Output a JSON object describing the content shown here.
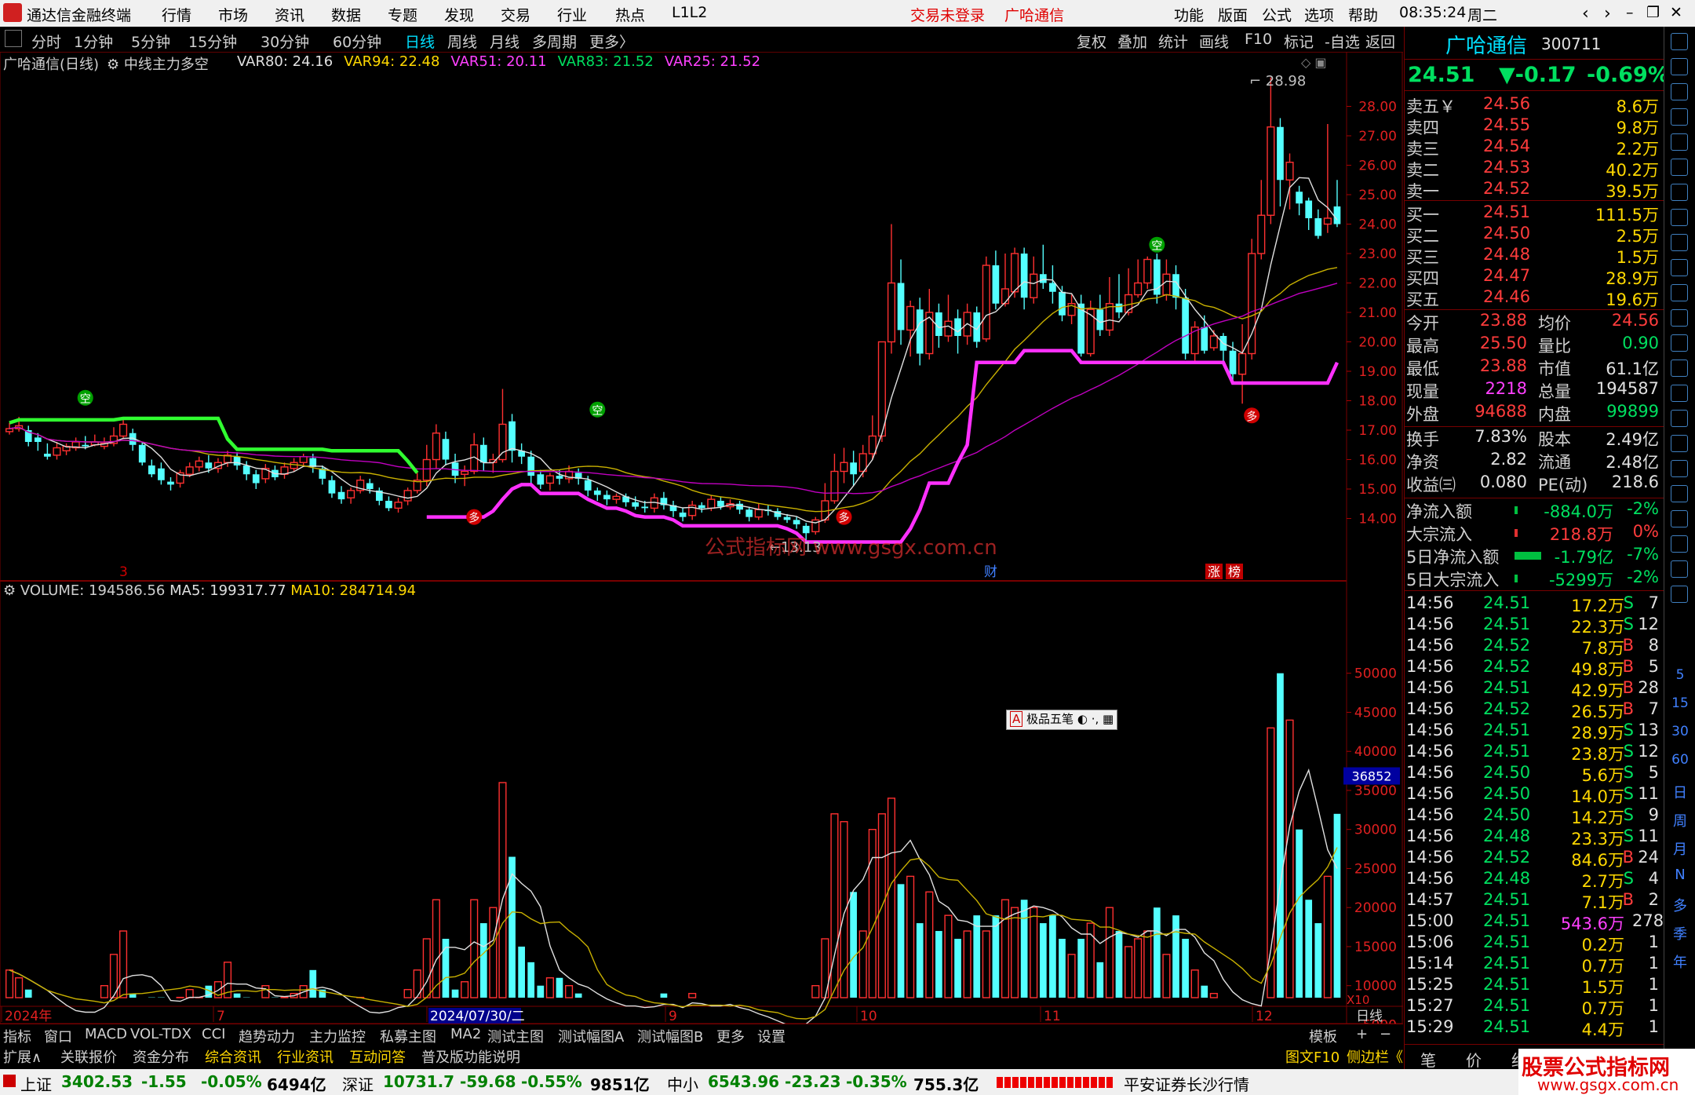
{
  "titlebar": {
    "app_name": "通达信金融终端",
    "menu": [
      "行情",
      "市场",
      "资讯",
      "数据",
      "专题",
      "发现",
      "交易",
      "行业",
      "热点",
      "L1L2"
    ],
    "notice_login": "交易未登录",
    "notice_stock": "广哈通信",
    "right_menu": [
      "功能",
      "版面",
      "公式",
      "选项",
      "帮助"
    ],
    "time": "08:35:24",
    "weekday": "周二"
  },
  "toolbar": {
    "periods": [
      "分时",
      "1分钟",
      "5分钟",
      "15分钟",
      "30分钟",
      "60分钟",
      "日线",
      "周线",
      "月线",
      "多周期",
      "更多〉"
    ],
    "active": "日线",
    "tools": [
      "复权",
      "叠加",
      "统计",
      "画线",
      "F10",
      "标记",
      "-自选",
      "返回"
    ]
  },
  "chart": {
    "title": "广哈通信(日线)",
    "indicator_name": "中线主力多空",
    "vars": [
      {
        "label": "VAR80: 24.16",
        "color": "#e0e0e0"
      },
      {
        "label": "VAR94: 22.48",
        "color": "#ffd800"
      },
      {
        "label": "VAR51: 20.11",
        "color": "#ff40ff"
      },
      {
        "label": "VAR83: 21.52",
        "color": "#00e060"
      },
      {
        "label": "VAR25: 21.52",
        "color": "#ff40ff"
      }
    ],
    "price_ticks": [
      "28.00",
      "27.00",
      "26.00",
      "25.00",
      "24.00",
      "23.00",
      "22.00",
      "21.00",
      "20.00",
      "19.00",
      "18.00",
      "17.00",
      "16.00",
      "15.00",
      "14.00"
    ],
    "high_label": "28.98",
    "low_label": "13.13",
    "watermark": "公式指标网 www.gsgx.com.cn",
    "markers": {
      "duo": "多",
      "kong": "空",
      "cai": "财",
      "zhang": "涨",
      "bang": "榜",
      "three": "3"
    },
    "volume_header": "VOLUME: 194586.56",
    "ma5_header": "MA5: 199317.77",
    "ma10_header": "MA10: 284714.94",
    "volume_ticks": [
      "50000",
      "45000",
      "40000",
      "35000",
      "30000",
      "25000",
      "20000",
      "15000",
      "10000",
      "5000"
    ],
    "volume_cursor": "36852",
    "volume_unit": "X10",
    "popup": "极品五笔",
    "date_labels": [
      "2024年",
      "7",
      "2024/07/30/二",
      "9",
      "10",
      "11",
      "12"
    ],
    "date_right": "日线"
  },
  "quote": {
    "name": "广哈通信",
    "code": "300711",
    "price": "24.51",
    "change": "▼-0.17",
    "pct": "-0.69%",
    "asks": [
      {
        "label": "卖五￥",
        "price": "24.56",
        "vol": "8.6万"
      },
      {
        "label": "卖四",
        "price": "24.55",
        "vol": "9.8万"
      },
      {
        "label": "卖三",
        "price": "24.54",
        "vol": "2.2万"
      },
      {
        "label": "卖二",
        "price": "24.53",
        "vol": "40.2万"
      },
      {
        "label": "卖一",
        "price": "24.52",
        "vol": "39.5万"
      }
    ],
    "bids": [
      {
        "label": "买一",
        "price": "24.51",
        "vol": "111.5万"
      },
      {
        "label": "买二",
        "price": "24.50",
        "vol": "2.5万"
      },
      {
        "label": "买三",
        "price": "24.48",
        "vol": "1.5万"
      },
      {
        "label": "买四",
        "price": "24.47",
        "vol": "28.9万"
      },
      {
        "label": "买五",
        "price": "24.46",
        "vol": "19.6万"
      }
    ],
    "stats": [
      {
        "l1": "今开",
        "v1": "23.88",
        "c1": "red",
        "l2": "均价",
        "v2": "24.56",
        "c2": "red"
      },
      {
        "l1": "最高",
        "v1": "25.50",
        "c1": "red",
        "l2": "量比",
        "v2": "0.90",
        "c2": "grn"
      },
      {
        "l1": "最低",
        "v1": "23.88",
        "c1": "red",
        "l2": "市值",
        "v2": "61.1亿",
        "c2": "wht"
      },
      {
        "l1": "现量",
        "v1": "2218",
        "c1": "mag",
        "l2": "总量",
        "v2": "194587",
        "c2": "wht"
      },
      {
        "l1": "外盘",
        "v1": "94688",
        "c1": "red",
        "l2": "内盘",
        "v2": "99899",
        "c2": "grn"
      }
    ],
    "stats2": [
      {
        "l1": "换手",
        "v1": "7.83%",
        "l2": "股本",
        "v2": "2.49亿"
      },
      {
        "l1": "净资",
        "v1": "2.82",
        "l2": "流通",
        "v2": "2.48亿"
      },
      {
        "l1": "收益㈢",
        "v1": "0.080",
        "l2": "PE(动)",
        "v2": "218.6"
      }
    ],
    "flows": [
      {
        "label": "净流入额",
        "value": "-884.0万",
        "pct": "-2%"
      },
      {
        "label": "大宗流入",
        "value": "218.8万",
        "pct": "0%"
      },
      {
        "label": "5日净流入额",
        "value": "-1.79亿",
        "pct": "-7%"
      },
      {
        "label": "5日大宗流入",
        "value": "-5299万",
        "pct": "-2%"
      }
    ],
    "ticks": [
      {
        "t": "14:56",
        "p": "24.51",
        "v": "17.2万",
        "s": "S",
        "n": "7"
      },
      {
        "t": "14:56",
        "p": "24.51",
        "v": "22.3万",
        "s": "S",
        "n": "12"
      },
      {
        "t": "14:56",
        "p": "24.52",
        "v": "7.8万",
        "s": "B",
        "n": "8"
      },
      {
        "t": "14:56",
        "p": "24.52",
        "v": "49.8万",
        "s": "B",
        "n": "5"
      },
      {
        "t": "14:56",
        "p": "24.51",
        "v": "42.9万",
        "s": "B",
        "n": "28"
      },
      {
        "t": "14:56",
        "p": "24.52",
        "v": "26.5万",
        "s": "B",
        "n": "7"
      },
      {
        "t": "14:56",
        "p": "24.51",
        "v": "28.9万",
        "s": "S",
        "n": "13"
      },
      {
        "t": "14:56",
        "p": "24.51",
        "v": "23.8万",
        "s": "S",
        "n": "12"
      },
      {
        "t": "14:56",
        "p": "24.50",
        "v": "5.6万",
        "s": "S",
        "n": "5"
      },
      {
        "t": "14:56",
        "p": "24.50",
        "v": "14.0万",
        "s": "S",
        "n": "11"
      },
      {
        "t": "14:56",
        "p": "24.50",
        "v": "14.2万",
        "s": "S",
        "n": "9"
      },
      {
        "t": "14:56",
        "p": "24.48",
        "v": "23.3万",
        "s": "S",
        "n": "11"
      },
      {
        "t": "14:56",
        "p": "24.52",
        "v": "84.6万",
        "s": "B",
        "n": "24"
      },
      {
        "t": "14:56",
        "p": "24.48",
        "v": "2.7万",
        "s": "S",
        "n": "4"
      },
      {
        "t": "14:57",
        "p": "24.51",
        "v": "7.1万",
        "s": "B",
        "n": "2"
      },
      {
        "t": "15:00",
        "p": "24.51",
        "v": "543.6万",
        "s": "",
        "n": "278"
      },
      {
        "t": "15:06",
        "p": "24.51",
        "v": "0.2万",
        "s": "",
        "n": "1"
      },
      {
        "t": "15:14",
        "p": "24.51",
        "v": "0.7万",
        "s": "",
        "n": "1"
      },
      {
        "t": "15:25",
        "p": "24.51",
        "v": "1.5万",
        "s": "",
        "n": "1"
      },
      {
        "t": "15:27",
        "p": "24.51",
        "v": "0.7万",
        "s": "",
        "n": "1"
      },
      {
        "t": "15:29",
        "p": "24.51",
        "v": "4.4万",
        "s": "",
        "n": "1"
      }
    ],
    "bottom_tabs": [
      "笔",
      "价",
      "细",
      "势"
    ],
    "f10": "图文F10",
    "sidebar": "侧边栏《"
  },
  "right_strip": [
    "日",
    "周",
    "月",
    "N",
    "多",
    "季",
    "年"
  ],
  "right_strip_nums": [
    "5",
    "15",
    "30",
    "60"
  ],
  "tabs1": [
    "指标",
    "窗口",
    "MACD",
    "VOL-TDX",
    "CCI",
    "趋势动力",
    "主力监控",
    "私募主图",
    "MA2",
    "测试主图",
    "测试幅图A",
    "测试幅图B",
    "更多",
    "设置"
  ],
  "tabs1_right": [
    "模板",
    "+",
    "−"
  ],
  "tabs2": [
    "扩展∧",
    "关联报价",
    "资金分布",
    "综合资讯",
    "行业资讯",
    "互动问答",
    "普及版功能说明"
  ],
  "status": {
    "sh_label": "上证",
    "sh_val": "3402.53",
    "sh_chg": "-1.55",
    "sh_pct": "-0.05%",
    "sh_amt": "6494亿",
    "sz_label": "深证",
    "sz_val": "10731.7",
    "sz_chg": "-59.68",
    "sz_pct": "-0.55%",
    "sz_amt": "9851亿",
    "zx_label": "中小",
    "zx_val": "6543.96",
    "zx_chg": "-23.23",
    "zx_pct": "-0.35%",
    "zx_amt": "755.3亿",
    "server": "平安证券长沙行情"
  },
  "brand": {
    "cn": "股票公式指标网",
    "url": "www.gsgx.com.cn"
  },
  "candles": [
    [
      16.95,
      17.05,
      17.25,
      16.85
    ],
    [
      17.05,
      17.15,
      17.45,
      16.95
    ],
    [
      17.0,
      16.6,
      17.15,
      16.45
    ],
    [
      16.75,
      16.6,
      16.9,
      16.3
    ],
    [
      16.2,
      16.1,
      16.55,
      16.0
    ],
    [
      16.15,
      16.4,
      16.6,
      16.0
    ],
    [
      16.3,
      16.45,
      16.55,
      16.15
    ],
    [
      16.4,
      16.6,
      16.75,
      16.3
    ],
    [
      16.5,
      16.45,
      16.8,
      16.35
    ],
    [
      16.5,
      16.6,
      16.85,
      16.45
    ],
    [
      16.45,
      16.55,
      16.75,
      16.35
    ],
    [
      16.55,
      16.8,
      17.1,
      16.45
    ],
    [
      16.8,
      17.2,
      17.45,
      16.7
    ],
    [
      16.9,
      16.5,
      17.05,
      16.3
    ],
    [
      16.5,
      15.9,
      16.6,
      15.8
    ],
    [
      15.8,
      15.5,
      16.0,
      15.4
    ],
    [
      15.7,
      15.3,
      15.9,
      15.15
    ],
    [
      15.25,
      15.15,
      15.4,
      14.95
    ],
    [
      15.2,
      15.55,
      15.65,
      15.05
    ],
    [
      15.5,
      15.75,
      15.9,
      15.4
    ],
    [
      15.75,
      15.95,
      16.1,
      15.6
    ],
    [
      15.9,
      15.7,
      16.15,
      15.55
    ],
    [
      15.7,
      15.9,
      16.05,
      15.55
    ],
    [
      15.9,
      16.15,
      16.3,
      15.75
    ],
    [
      16.1,
      15.8,
      16.25,
      15.65
    ],
    [
      15.8,
      15.5,
      15.95,
      15.3
    ],
    [
      15.5,
      15.2,
      15.65,
      15.0
    ],
    [
      15.35,
      15.7,
      15.85,
      15.2
    ],
    [
      15.65,
      15.4,
      15.8,
      15.3
    ],
    [
      15.5,
      15.75,
      15.9,
      15.35
    ],
    [
      15.7,
      15.9,
      16.05,
      15.6
    ],
    [
      15.9,
      16.1,
      16.2,
      15.75
    ],
    [
      16.05,
      15.75,
      16.2,
      15.55
    ],
    [
      15.7,
      15.35,
      15.8,
      15.15
    ],
    [
      15.3,
      14.85,
      15.45,
      14.7
    ],
    [
      14.9,
      14.65,
      15.1,
      14.5
    ],
    [
      14.7,
      14.95,
      15.05,
      14.5
    ],
    [
      14.95,
      15.3,
      15.45,
      14.85
    ],
    [
      15.2,
      15.0,
      15.35,
      14.85
    ],
    [
      14.95,
      14.6,
      15.05,
      14.45
    ],
    [
      14.6,
      14.35,
      14.75,
      14.25
    ],
    [
      14.35,
      14.55,
      14.7,
      14.2
    ],
    [
      14.6,
      14.95,
      15.05,
      14.45
    ],
    [
      14.95,
      15.3,
      15.55,
      14.85
    ],
    [
      15.3,
      16.0,
      16.5,
      15.1
    ],
    [
      16.0,
      16.9,
      17.2,
      15.7
    ],
    [
      16.7,
      16.0,
      16.95,
      15.8
    ],
    [
      15.9,
      15.45,
      16.2,
      15.2
    ],
    [
      15.5,
      15.6,
      15.8,
      15.1
    ],
    [
      15.6,
      16.5,
      16.9,
      15.5
    ],
    [
      16.5,
      15.9,
      16.75,
      15.6
    ],
    [
      15.9,
      16.0,
      16.2,
      15.55
    ],
    [
      16.0,
      17.2,
      18.4,
      15.9
    ],
    [
      17.3,
      16.3,
      17.55,
      15.9
    ],
    [
      16.3,
      16.1,
      16.55,
      15.85
    ],
    [
      16.1,
      15.45,
      16.3,
      15.2
    ],
    [
      15.5,
      15.15,
      15.65,
      15.0
    ],
    [
      15.2,
      15.45,
      15.55,
      14.95
    ],
    [
      15.45,
      15.35,
      15.65,
      15.15
    ],
    [
      15.35,
      15.6,
      15.8,
      15.2
    ],
    [
      15.55,
      15.35,
      15.7,
      15.15
    ],
    [
      15.3,
      14.95,
      15.45,
      14.75
    ],
    [
      14.95,
      14.8,
      15.05,
      14.6
    ],
    [
      14.8,
      14.65,
      14.95,
      14.45
    ],
    [
      14.65,
      14.75,
      14.85,
      14.5
    ],
    [
      14.75,
      14.55,
      14.85,
      14.4
    ],
    [
      14.55,
      14.4,
      14.75,
      14.3
    ],
    [
      14.4,
      14.35,
      14.6,
      14.2
    ],
    [
      14.35,
      14.7,
      14.85,
      14.2
    ],
    [
      14.7,
      14.45,
      14.9,
      14.3
    ],
    [
      14.45,
      14.25,
      14.6,
      14.05
    ],
    [
      14.2,
      14.05,
      14.35,
      13.9
    ],
    [
      14.1,
      14.45,
      14.6,
      13.95
    ],
    [
      14.45,
      14.35,
      14.55,
      14.2
    ],
    [
      14.35,
      14.65,
      14.8,
      14.25
    ],
    [
      14.6,
      14.4,
      14.75,
      14.3
    ],
    [
      14.4,
      14.5,
      14.65,
      14.3
    ],
    [
      14.5,
      14.3,
      14.6,
      14.15
    ],
    [
      14.3,
      14.05,
      14.4,
      13.9
    ],
    [
      14.05,
      14.3,
      14.5,
      13.95
    ],
    [
      14.3,
      14.25,
      14.45,
      14.1
    ],
    [
      14.25,
      14.05,
      14.35,
      13.95
    ],
    [
      14.05,
      13.95,
      14.15,
      13.85
    ],
    [
      13.95,
      13.8,
      14.05,
      13.65
    ],
    [
      13.75,
      13.5,
      13.85,
      13.13
    ],
    [
      13.55,
      13.95,
      14.05,
      13.45
    ],
    [
      13.95,
      14.6,
      15.2,
      13.85
    ],
    [
      14.6,
      15.6,
      16.2,
      14.5
    ],
    [
      15.6,
      15.9,
      16.4,
      15.2
    ],
    [
      15.9,
      15.5,
      16.3,
      15.1
    ],
    [
      15.6,
      16.2,
      16.5,
      15.4
    ],
    [
      16.2,
      16.8,
      17.5,
      16.0
    ],
    [
      16.8,
      20.0,
      20.0,
      16.6
    ],
    [
      20.0,
      22.0,
      24.0,
      19.6
    ],
    [
      22.0,
      20.4,
      22.8,
      19.9
    ],
    [
      20.4,
      21.2,
      21.4,
      19.5
    ],
    [
      21.1,
      19.6,
      21.5,
      19.2
    ],
    [
      19.6,
      21.0,
      21.8,
      19.4
    ],
    [
      21.0,
      20.2,
      21.3,
      19.8
    ],
    [
      20.2,
      20.7,
      21.6,
      20.0
    ],
    [
      20.8,
      20.2,
      21.1,
      19.6
    ],
    [
      20.2,
      21.0,
      21.3,
      19.9
    ],
    [
      21.0,
      20.0,
      21.2,
      19.8
    ],
    [
      20.1,
      22.6,
      22.9,
      20.0
    ],
    [
      22.6,
      21.3,
      23.1,
      21.1
    ],
    [
      21.3,
      21.8,
      23.0,
      21.2
    ],
    [
      21.7,
      23.0,
      23.2,
      21.5
    ],
    [
      23.0,
      21.5,
      23.2,
      21.1
    ],
    [
      21.5,
      22.3,
      22.9,
      21.3
    ],
    [
      22.3,
      22.0,
      23.3,
      21.8
    ],
    [
      22.0,
      21.7,
      22.6,
      21.3
    ],
    [
      21.7,
      20.9,
      21.9,
      20.7
    ],
    [
      20.9,
      21.3,
      21.6,
      20.6
    ],
    [
      21.3,
      19.6,
      21.6,
      19.5
    ],
    [
      19.6,
      21.1,
      21.4,
      19.5
    ],
    [
      21.1,
      20.4,
      21.6,
      20.2
    ],
    [
      20.4,
      21.3,
      22.2,
      20.2
    ],
    [
      21.3,
      21.0,
      22.3,
      20.8
    ],
    [
      21.0,
      21.6,
      22.5,
      20.9
    ],
    [
      21.6,
      22.0,
      22.8,
      21.5
    ],
    [
      22.0,
      22.8,
      22.9,
      21.8
    ],
    [
      22.8,
      21.6,
      23.0,
      21.3
    ],
    [
      21.6,
      22.3,
      22.8,
      21.4
    ],
    [
      22.3,
      21.5,
      22.6,
      21.1
    ],
    [
      21.5,
      19.6,
      21.8,
      19.4
    ],
    [
      19.6,
      20.5,
      20.7,
      19.3
    ],
    [
      20.5,
      19.7,
      20.9,
      19.6
    ],
    [
      19.8,
      20.2,
      20.4,
      19.7
    ],
    [
      20.2,
      19.7,
      20.3,
      19.3
    ],
    [
      19.7,
      18.9,
      20.0,
      18.7
    ],
    [
      18.9,
      19.6,
      20.6,
      17.9
    ],
    [
      19.6,
      23.0,
      23.5,
      19.4
    ],
    [
      23.0,
      24.3,
      25.5,
      22.8
    ],
    [
      24.3,
      27.3,
      28.98,
      24.0
    ],
    [
      27.3,
      25.5,
      27.6,
      24.6
    ],
    [
      25.5,
      26.1,
      26.4,
      24.5
    ],
    [
      25.1,
      24.7,
      25.3,
      24.3
    ],
    [
      24.8,
      24.2,
      24.9,
      23.8
    ],
    [
      24.2,
      23.6,
      24.5,
      23.5
    ],
    [
      24.0,
      24.2,
      27.4,
      23.7
    ],
    [
      24.6,
      24.0,
      25.5,
      23.9
    ]
  ],
  "volumes": [
    12,
    11,
    9.5,
    8,
    6.5,
    7,
    6.5,
    6,
    7,
    6.5,
    10,
    14,
    17,
    9,
    7,
    8.5,
    8.5,
    7.5,
    8.5,
    9.5,
    8.5,
    10,
    10.5,
    13,
    9,
    8.5,
    7.5,
    10,
    8.5,
    8.5,
    9,
    10,
    12,
    9.5,
    7,
    6,
    5.5,
    8.5,
    6,
    6.5,
    7,
    8,
    9.5,
    12,
    16,
    21,
    16,
    9.5,
    10.5,
    21,
    18,
    20,
    36,
    26.5,
    15,
    13,
    10,
    11,
    11,
    10,
    9,
    8,
    7,
    7.5,
    7.5,
    7,
    8,
    6,
    8,
    9,
    7,
    6,
    9,
    7.5,
    7.5,
    7,
    7,
    7,
    6,
    5,
    5,
    4.5,
    4.5,
    4.5,
    7,
    10,
    16,
    32,
    31,
    22,
    17,
    30,
    32,
    34,
    23,
    24,
    18,
    22,
    17,
    19,
    16,
    17,
    19,
    17,
    19,
    21,
    20,
    21,
    20,
    18,
    19,
    16,
    14,
    16,
    18,
    13,
    20,
    17,
    15,
    16,
    17,
    20,
    14,
    19,
    16,
    12,
    10,
    9,
    7,
    8,
    7,
    7.5,
    7.5,
    43,
    50,
    44,
    30,
    21,
    18,
    24,
    32,
    19.5
  ]
}
